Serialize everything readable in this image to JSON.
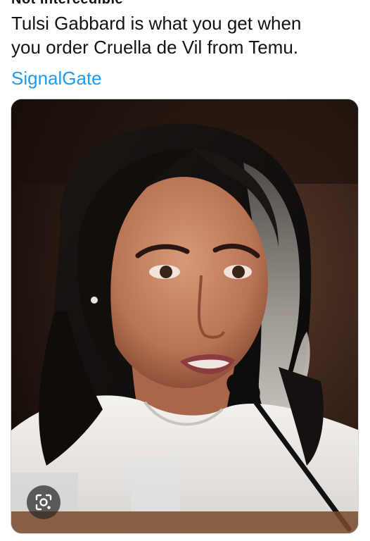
{
  "tweet": {
    "author_partial": "Not Intercedible",
    "text_line1": "Tulsi Gabbard is what you get when",
    "text_line2": "you order Cruella de Vil from Temu.",
    "hashtag": "SignalGate"
  },
  "media": {
    "lens_button_icon": "visual-search-icon"
  },
  "colors": {
    "link": "#1d9bf0",
    "text": "#0f1419",
    "background": "#ffffff"
  }
}
